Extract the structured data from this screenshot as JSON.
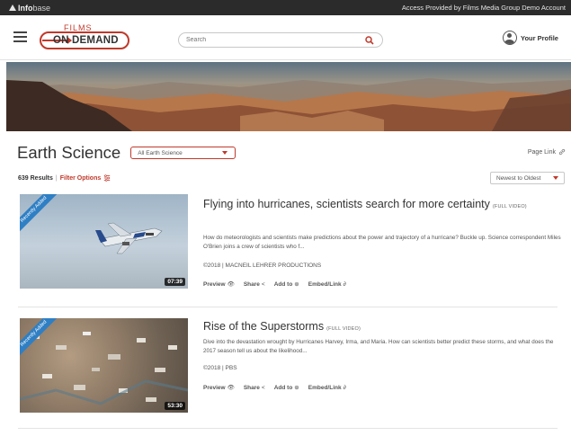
{
  "topbar": {
    "brand_strong": "Info",
    "brand_light": "base",
    "access_text": "Access Provided by Films Media Group Demo Account"
  },
  "header": {
    "logo_films": "FILMS",
    "logo_ondemand": "ON DEMAND",
    "search_placeholder": "Search",
    "profile_label": "Your Profile"
  },
  "page": {
    "title": "Earth Science",
    "category_select": "All Earth Science",
    "page_link": "Page Link",
    "results_count": "639 Results",
    "separator": "|",
    "filter_label": "Filter Options",
    "sort_label": "Newest to Oldest"
  },
  "results": [
    {
      "ribbon": "Recently Added",
      "duration": "07:39",
      "title": "Flying into hurricanes, scientists search for more certainty",
      "tag": "(FULL VIDEO)",
      "desc": "How do meteorologists and scientists make predictions about the power and trajectory of a hurricane? Buckle up. Science correspondent Miles O'Brien joins a crew of scientists who f...",
      "meta": "©2018 | MACNEIL LEHRER PRODUCTIONS",
      "actions": [
        "Preview",
        "Share",
        "Add to",
        "Embed/Link"
      ]
    },
    {
      "ribbon": "Recently Added",
      "duration": "53:30",
      "title": "Rise of the Superstorms",
      "tag": "(FULL VIDEO)",
      "desc": "Dive into the devastation wrought by Hurricanes Harvey, Irma, and Maria. How can scientists better predict these storms, and what does the 2017 season tell us about the likelihood...",
      "meta": "©2018 | PBS",
      "actions": [
        "Preview",
        "Share",
        "Add to",
        "Embed/Link"
      ]
    }
  ],
  "colors": {
    "accent": "#c0392b",
    "ribbon": "#2f7fc4",
    "topbar": "#2b2b2b"
  }
}
